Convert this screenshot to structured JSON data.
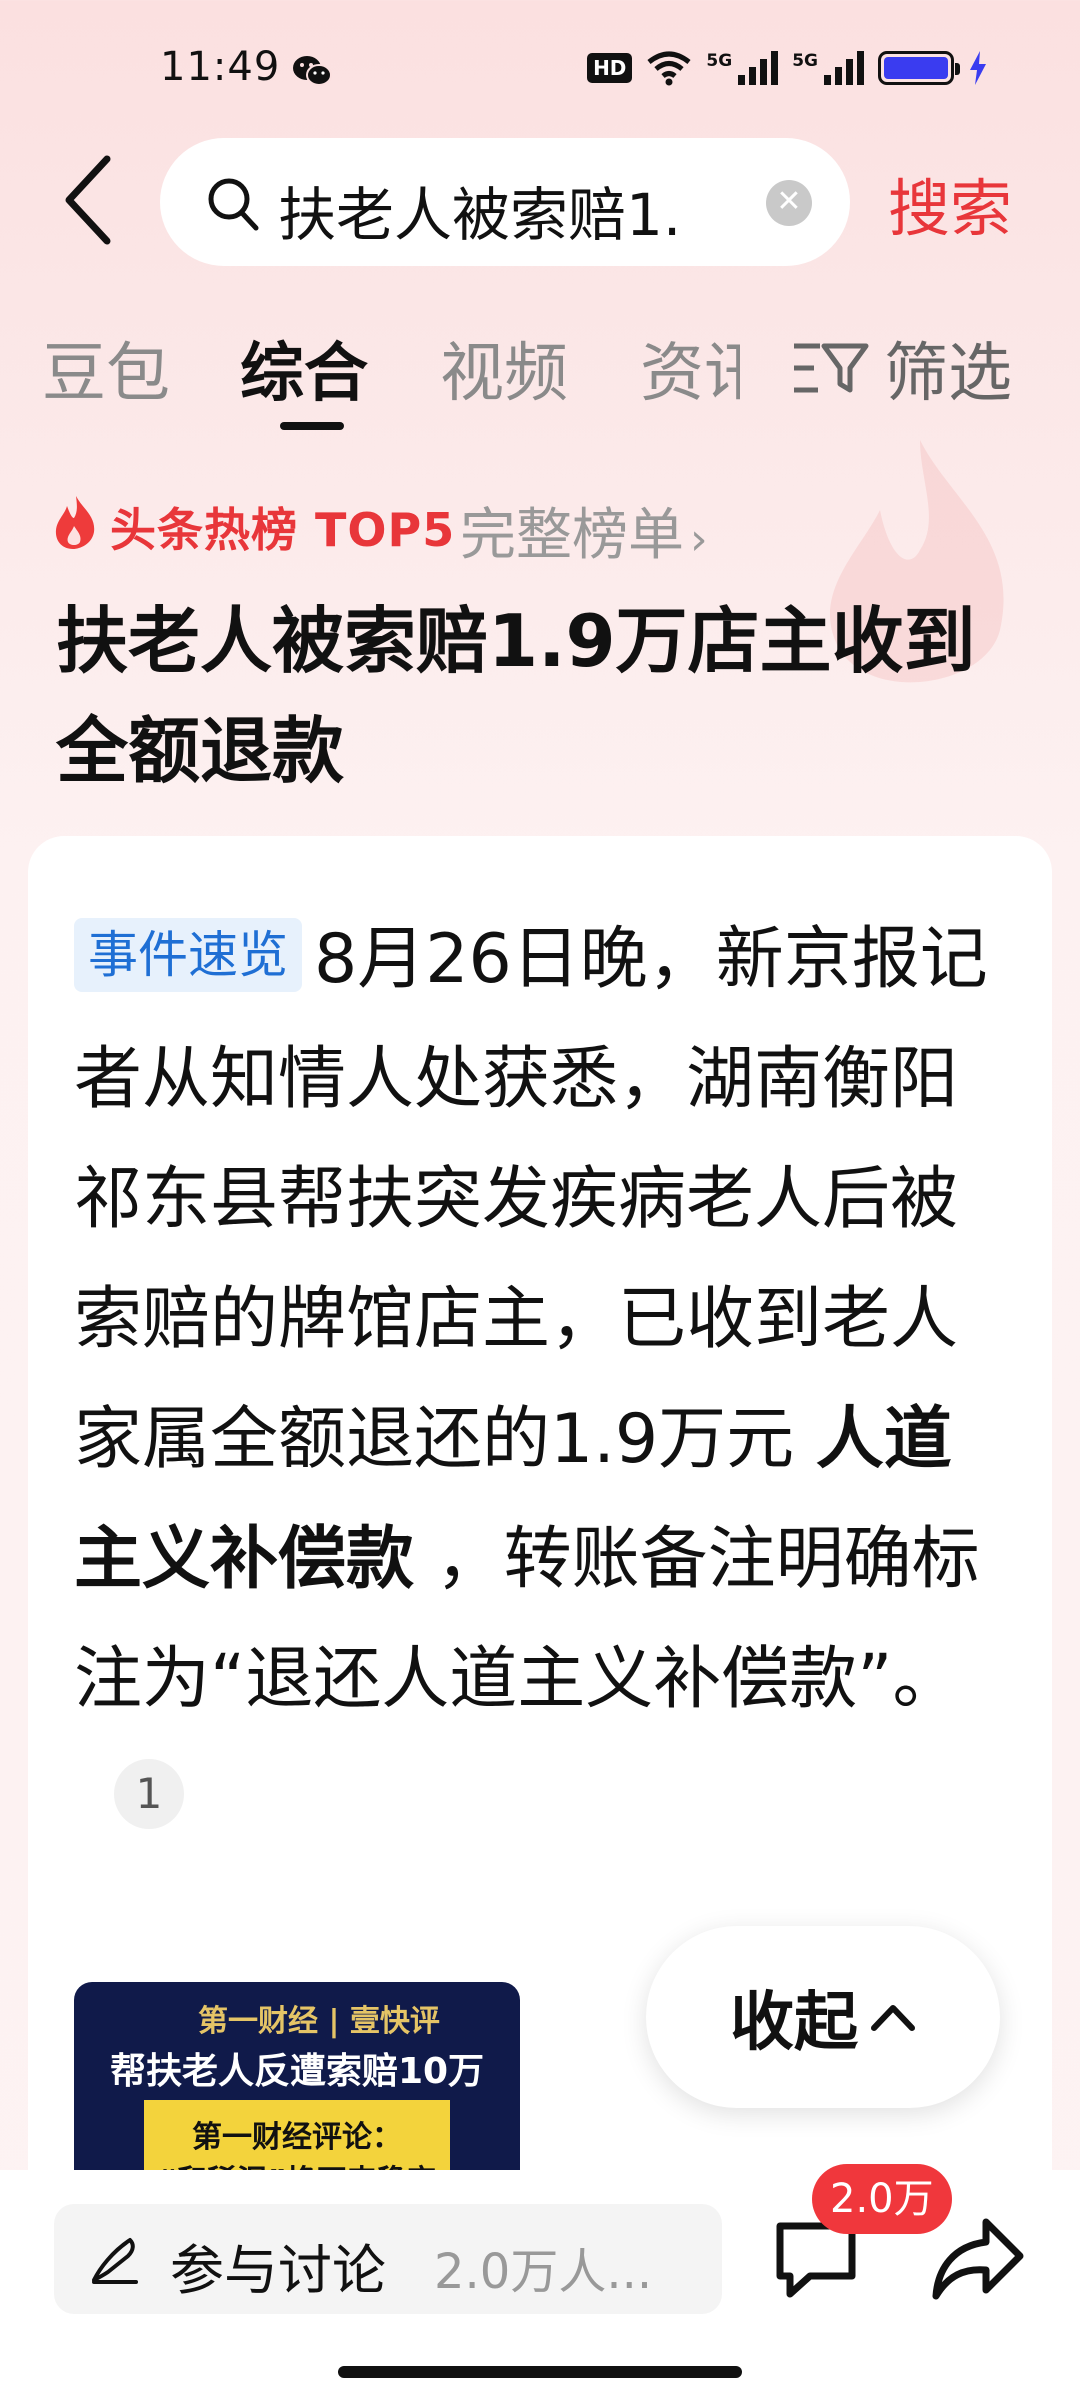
{
  "status_bar": {
    "time": "11:49",
    "network_label": "HD",
    "signal1_label": "5G",
    "signal2_label": "5G",
    "battery_color": "#3a3cf0"
  },
  "search": {
    "query": "扶老人被索赔1.",
    "button_label": "搜索"
  },
  "tabs": [
    {
      "label": "豆包",
      "active": false
    },
    {
      "label": "综合",
      "active": true
    },
    {
      "label": "视频",
      "active": false
    },
    {
      "label": "资讯",
      "active": false
    }
  ],
  "filter_label": "筛选",
  "hot_list": {
    "label": "头条热榜 TOP5",
    "link_label": "完整榜单"
  },
  "headline": "扶老人被索赔1.9万店主收到全额退款",
  "card": {
    "tag": "事件速览",
    "text_part1": "8月26日晚，新京报记者从知情人处获悉，湖南衡阳祁东县帮扶突发疾病老人后被索赔的牌馆店主，已收到老人家属全额退还的1.9万元 ",
    "text_bold": "人道主义补偿款",
    "text_part2": " ，转账备注明确标注为“退还人道主义补偿款”。",
    "reference_number": "1",
    "thumbnail": {
      "brand": "第一财经 | 壹快评",
      "title": "帮扶老人反遭索赔10万",
      "subtitle_line1": "第一财经评论：",
      "subtitle_line2": "“和稀泥”换不来稳定"
    },
    "collapse_label": "收起"
  },
  "bottom_bar": {
    "discuss_label": "参与讨论",
    "discuss_count": "2.0万人...",
    "comment_badge": "2.0万"
  },
  "colors": {
    "accent_red": "#e8363a",
    "tag_blue": "#1f6fd4",
    "tag_bg": "#e7f1fc"
  }
}
